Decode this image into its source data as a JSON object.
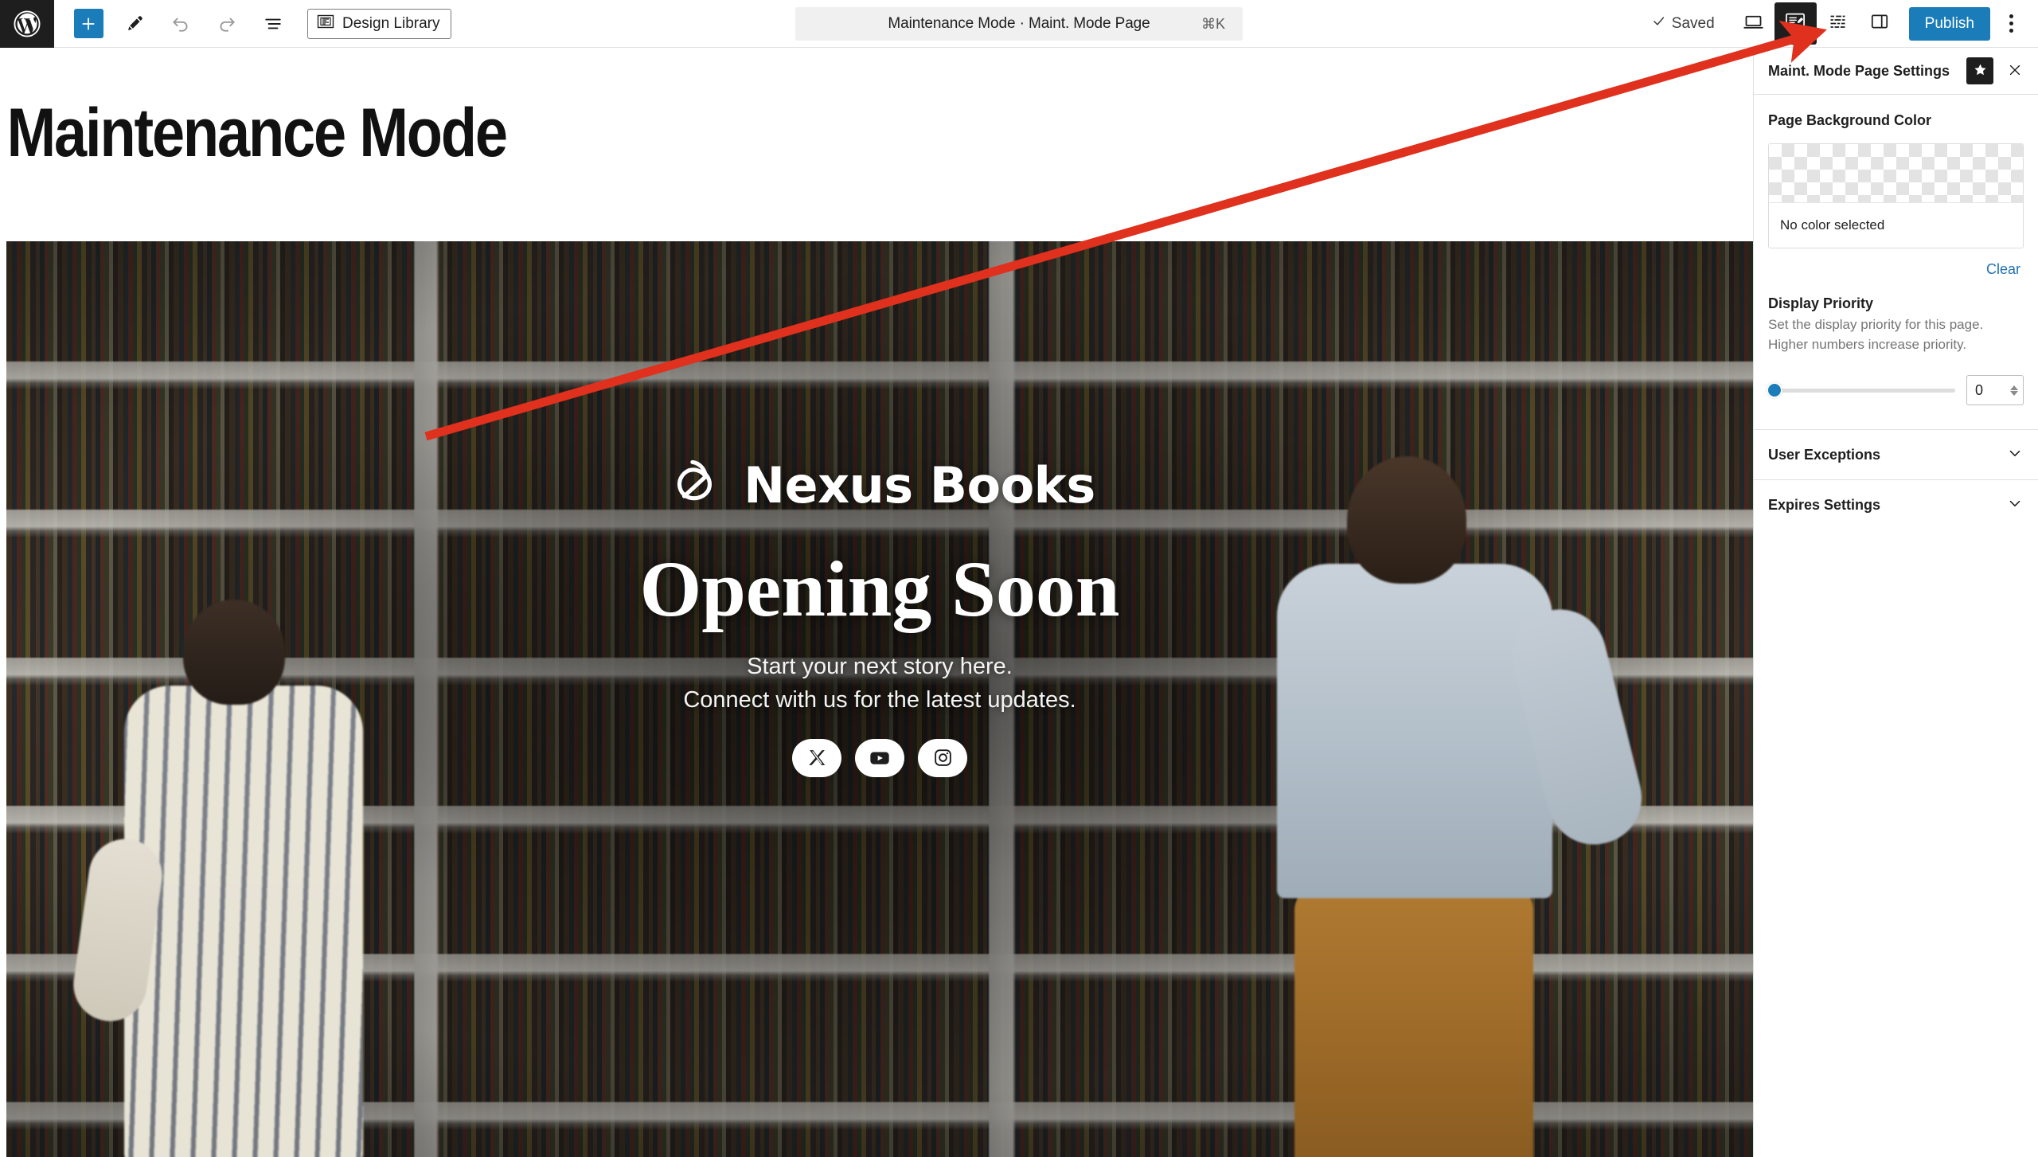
{
  "toolbar": {
    "wp_logo_label": "WordPress",
    "add_block_label": "+",
    "tools_label": "Edit",
    "undo_label": "Undo",
    "redo_label": "Redo",
    "list_view_label": "Document Overview",
    "design_library_label": "Design Library",
    "document_title": "Maintenance Mode · Maint. Mode Page",
    "document_shortcut": "⌘K",
    "save_state": "Saved",
    "preview_label": "View",
    "maint_mode_label": "Maint. Mode Page Settings",
    "styles_label": "Styles",
    "sidebar_toggle_label": "Settings",
    "publish_label": "Publish",
    "options_label": "Options"
  },
  "canvas": {
    "post_title": "Maintenance Mode",
    "cover": {
      "brand_name": "Nexus Books",
      "logo_name": "nexus-books-logo",
      "headline": "Opening Soon",
      "tagline_line_1": "Start your next story here.",
      "tagline_line_2": "Connect with us for the latest updates.",
      "social": [
        {
          "name": "x-twitter-icon",
          "label": "X"
        },
        {
          "name": "youtube-icon",
          "label": "YouTube"
        },
        {
          "name": "instagram-icon",
          "label": "Instagram"
        }
      ]
    }
  },
  "sidebar": {
    "header_title": "Maint. Mode Page Settings",
    "pin_label": "Pin to toolbar",
    "close_label": "Close settings",
    "background_color": {
      "label": "Page Background Color",
      "readout": "No color selected",
      "clear_label": "Clear"
    },
    "display_priority": {
      "title": "Display Priority",
      "help": "Set the display priority for this page. Higher numbers increase priority.",
      "value": "0",
      "slider_percent": 0
    },
    "accordions": [
      {
        "label": "User Exceptions"
      },
      {
        "label": "Expires Settings"
      }
    ]
  },
  "annotation": {
    "color": "#e0301e",
    "kind": "pointer-arrow"
  }
}
